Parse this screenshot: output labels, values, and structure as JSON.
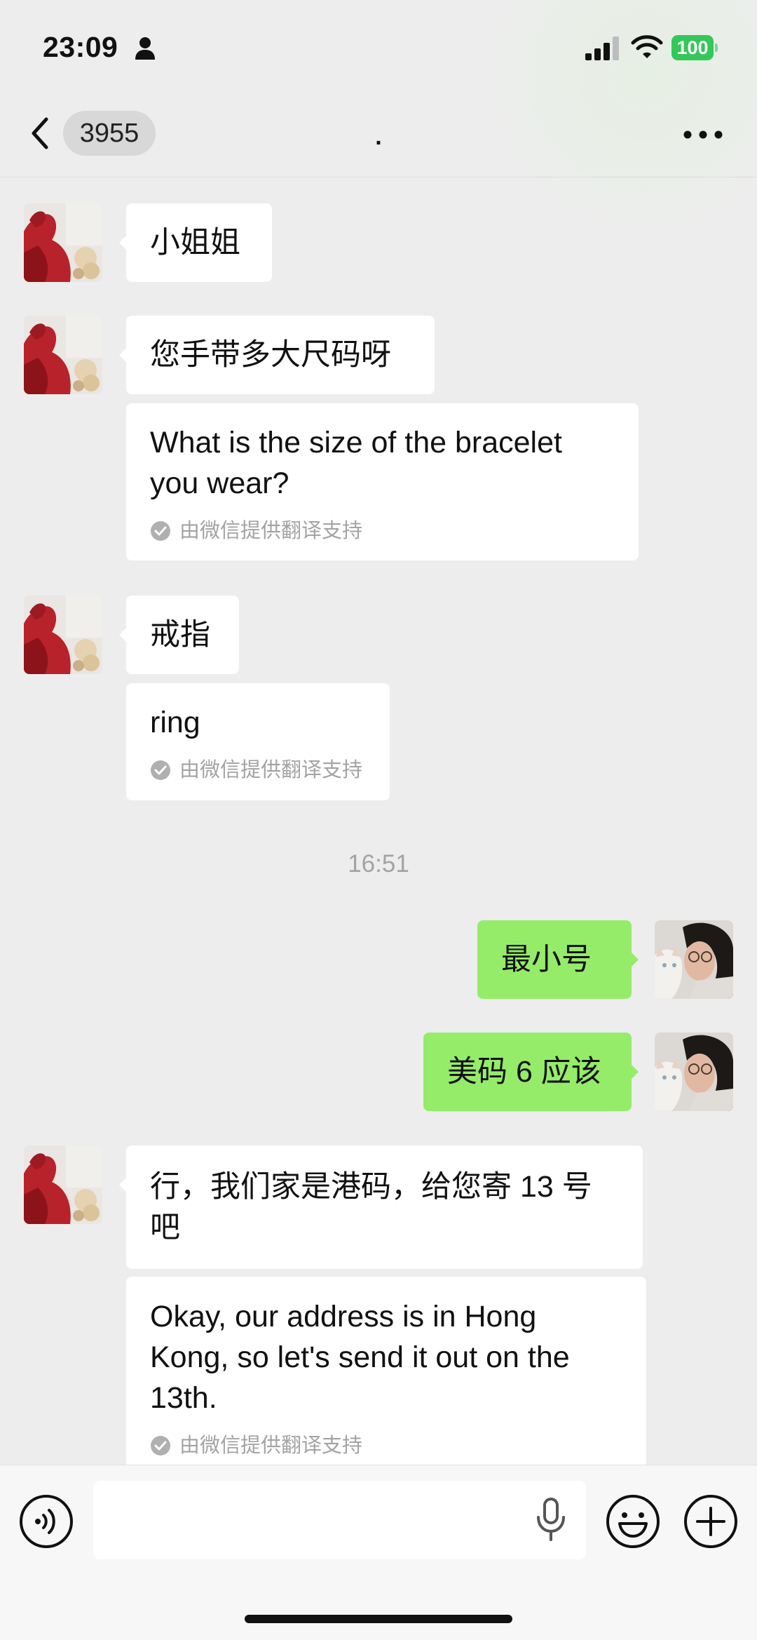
{
  "status_bar": {
    "time": "23:09",
    "battery": "100"
  },
  "nav": {
    "unread_count": "3955",
    "title": "."
  },
  "messages": [
    {
      "text": "小姐姐"
    },
    {
      "text": "您手带多大尺码呀",
      "translation": "What is the size of the bracelet\nyou wear?",
      "translation_note": "由微信提供翻译支持"
    },
    {
      "text": "戒指",
      "translation": "ring",
      "translation_note": "由微信提供翻译支持"
    },
    {
      "text": "最小号"
    },
    {
      "text": "美码 6 应该"
    },
    {
      "text": "行，我们家是港码，给您寄 13 号\n吧",
      "translation": "Okay, our address is in Hong\nKong, so let's send it out on the\n13th.",
      "translation_note": "由微信提供翻译支持"
    }
  ],
  "timestamp": "16:51",
  "input": {
    "value": ""
  },
  "colors": {
    "outgoing_bubble": "#95ec69",
    "incoming_bubble": "#ffffff",
    "background": "#ededed",
    "battery": "#34c759"
  }
}
